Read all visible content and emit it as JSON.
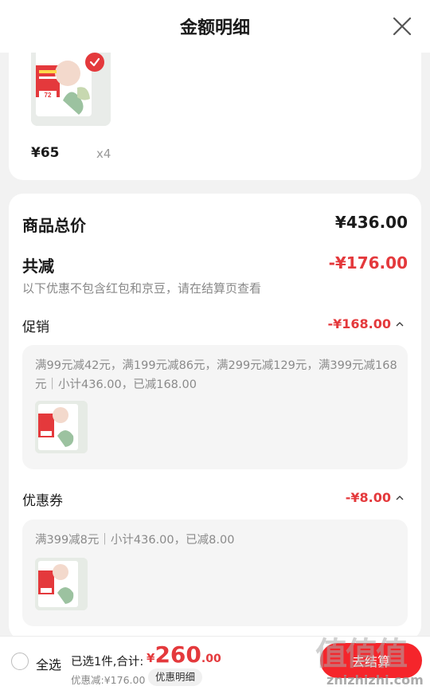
{
  "header": {
    "title": "金额明细",
    "close_icon": "close-icon"
  },
  "product": {
    "price": "¥65",
    "quantity": "x4",
    "image_icon": "diaper-package-image",
    "selected_icon": "check-icon"
  },
  "summary": {
    "total_label": "商品总价",
    "total_value": "¥436.00",
    "reduction_label": "共减",
    "reduction_value": "-¥176.00",
    "note": "以下优惠不包含红包和京豆，请在结算页查看"
  },
  "promotion": {
    "title": "促销",
    "amount": "-¥168.00",
    "description": "满99元减42元，满199元减86元，满299元减129元，满399元减168元｜小计436.00，已减168.00"
  },
  "coupon": {
    "title": "优惠券",
    "amount": "-¥8.00",
    "description": "满399减8元｜小计436.00，已减8.00"
  },
  "footer": {
    "select_all": "全选",
    "selected_info": "已选1件,合计:",
    "total_currency": "¥",
    "total_int": "260",
    "total_dec": ".00",
    "discount_text": "优惠减:¥176.00",
    "detail_button": "优惠明细",
    "checkout_label": "去结算"
  },
  "watermark": {
    "glyphs": "值值值",
    "url": "znizhizhi.com"
  },
  "colors": {
    "accent": "#e4393c",
    "checkout": "#f5252b",
    "background": "#f2f2f2"
  }
}
